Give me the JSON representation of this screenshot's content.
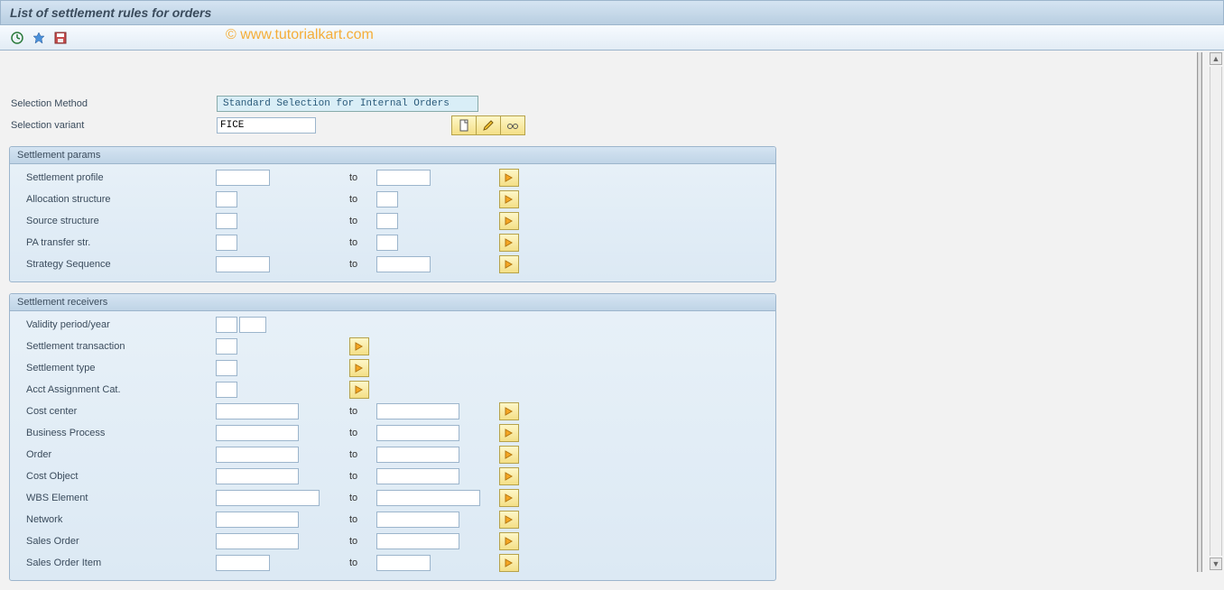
{
  "title": "List of settlement rules for orders",
  "watermark": "© www.tutorialkart.com",
  "selection": {
    "method_label": "Selection Method",
    "method_value": "Standard Selection for Internal Orders",
    "variant_label": "Selection variant",
    "variant_value": "FICE"
  },
  "to_label": "to",
  "groups": {
    "params": {
      "title": "Settlement params",
      "rows": [
        {
          "label": "Settlement profile",
          "size_from": "m",
          "size_to": "m"
        },
        {
          "label": "Allocation structure",
          "size_from": "xs",
          "size_to": "xs"
        },
        {
          "label": "Source structure",
          "size_from": "xs",
          "size_to": "xs"
        },
        {
          "label": "PA transfer str.",
          "size_from": "xs",
          "size_to": "xs"
        },
        {
          "label": "Strategy Sequence",
          "size_from": "m",
          "size_to": "m"
        }
      ]
    },
    "receivers": {
      "title": "Settlement receivers",
      "validity_label": "Validity period/year",
      "simple_rows": [
        {
          "label": "Settlement transaction",
          "size": "xs"
        },
        {
          "label": "Settlement type",
          "size": "xs"
        },
        {
          "label": "Acct Assignment Cat.",
          "size": "xs"
        }
      ],
      "range_rows": [
        {
          "label": "Cost center",
          "size_from": "l",
          "size_to": "l"
        },
        {
          "label": "Business Process",
          "size_from": "l",
          "size_to": "l"
        },
        {
          "label": "Order",
          "size_from": "l",
          "size_to": "l"
        },
        {
          "label": "Cost Object",
          "size_from": "l",
          "size_to": "l"
        },
        {
          "label": "WBS Element",
          "size_from": "xl",
          "size_to": "xl"
        },
        {
          "label": "Network",
          "size_from": "l",
          "size_to": "l"
        },
        {
          "label": "Sales Order",
          "size_from": "l",
          "size_to": "l"
        },
        {
          "label": "Sales Order Item",
          "size_from": "m",
          "size_to": "m"
        }
      ]
    }
  }
}
